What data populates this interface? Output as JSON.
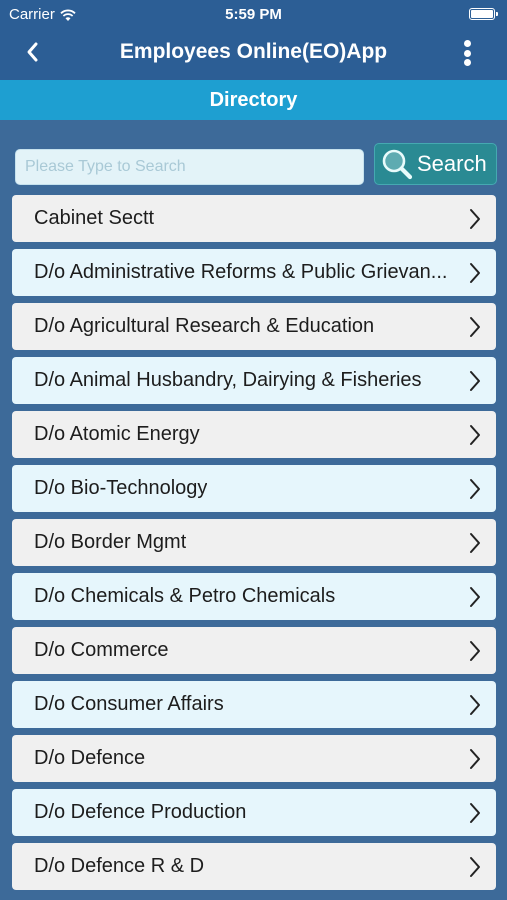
{
  "status_bar": {
    "carrier": "Carrier",
    "time": "5:59 PM"
  },
  "nav": {
    "title": "Employees Online(EO)App"
  },
  "section": {
    "title": "Directory"
  },
  "search": {
    "placeholder": "Please Type to Search",
    "value": "",
    "button_label": "Search"
  },
  "directory": [
    {
      "label": "Cabinet Sectt"
    },
    {
      "label": "D/o Administrative Reforms & Public Grievan..."
    },
    {
      "label": "D/o Agricultural Research & Education"
    },
    {
      "label": "D/o Animal Husbandry, Dairying & Fisheries"
    },
    {
      "label": "D/o Atomic Energy"
    },
    {
      "label": "D/o Bio-Technology"
    },
    {
      "label": "D/o Border Mgmt"
    },
    {
      "label": "D/o Chemicals & Petro Chemicals"
    },
    {
      "label": "D/o Commerce"
    },
    {
      "label": "D/o Consumer Affairs"
    },
    {
      "label": "D/o Defence"
    },
    {
      "label": "D/o Defence Production"
    },
    {
      "label": "D/o Defence R & D"
    }
  ],
  "icons": {
    "back": "chevron-left-icon",
    "menu": "more-vertical-icon",
    "search": "magnifier-icon",
    "row": "chevron-right-icon"
  },
  "colors": {
    "nav_bar": "#2c5e95",
    "section_bar": "#1e9fd1",
    "page_bg": "#3d6a99",
    "search_button": "#2a8a93",
    "row_odd": "#f0f0f0",
    "row_even": "#e6f6fc"
  }
}
